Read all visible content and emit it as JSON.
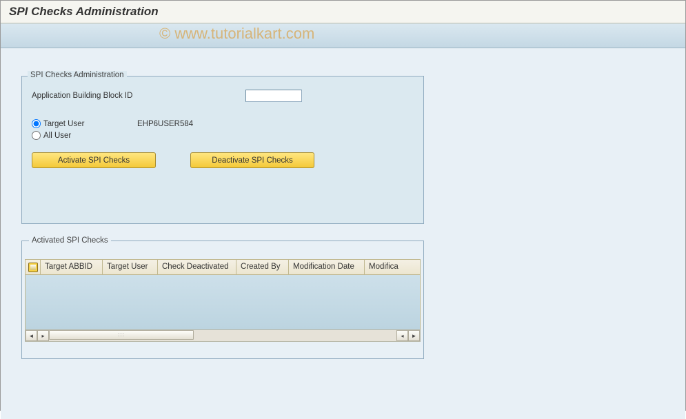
{
  "page_title": "SPI Checks Administration",
  "watermark": "© www.tutorialkart.com",
  "admin_box": {
    "title": "SPI Checks Administration",
    "app_block_label": "Application Building Block ID",
    "app_block_value": "",
    "target_user_label": "Target User",
    "target_user_value": "EHP6USER584",
    "all_user_label": "All User",
    "selected_radio": "target",
    "activate_btn": "Activate SPI Checks",
    "deactivate_btn": "Deactivate SPI Checks"
  },
  "list_box": {
    "title": "Activated SPI Checks",
    "columns": [
      "Target ABBID",
      "Target User",
      "Check Deactivated",
      "Created By",
      "Modification Date",
      "Modifica"
    ],
    "rows": []
  }
}
